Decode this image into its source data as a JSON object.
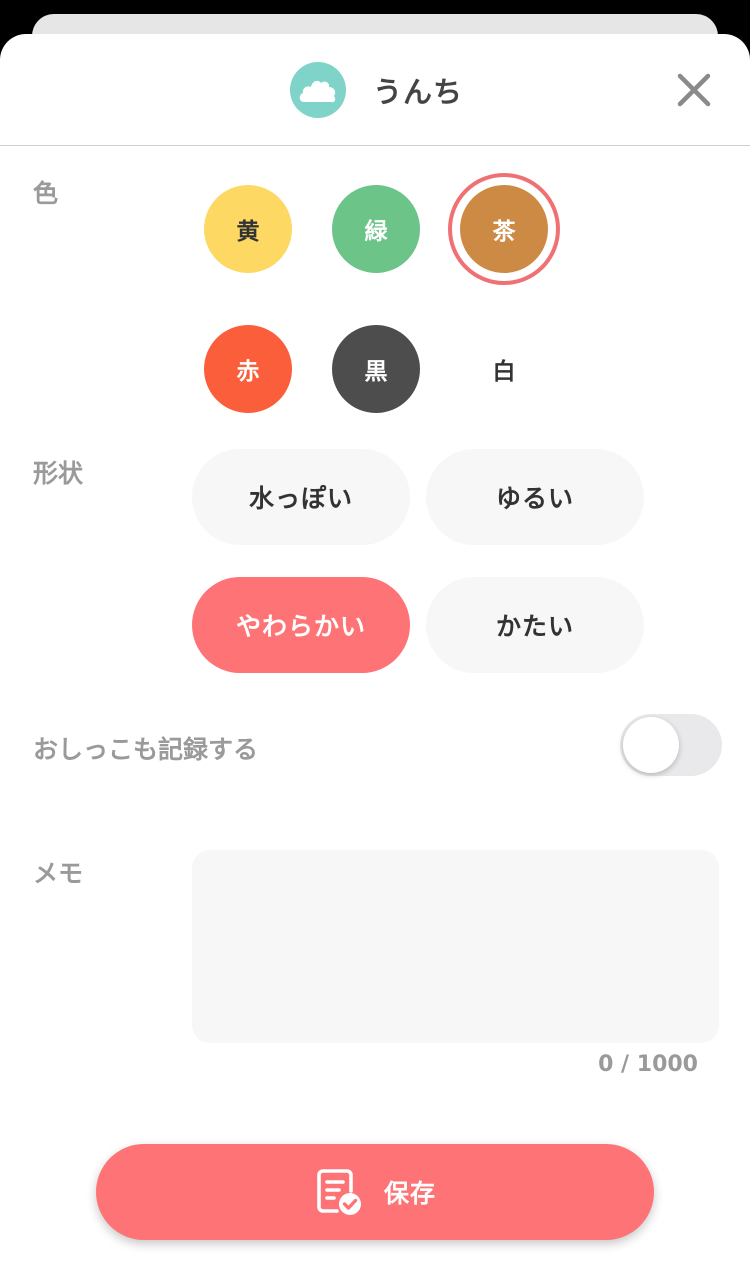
{
  "header": {
    "title": "うんち",
    "icon": "poop-cloud-icon",
    "close_icon": "close-icon"
  },
  "color_section": {
    "label": "色",
    "options": [
      {
        "label": "黄",
        "bg": "#fdd964",
        "fg": "#333333",
        "selected": false
      },
      {
        "label": "緑",
        "bg": "#6cc489",
        "fg": "#ffffff",
        "selected": false
      },
      {
        "label": "茶",
        "bg": "#cd8a45",
        "fg": "#ffffff",
        "selected": true
      },
      {
        "label": "赤",
        "bg": "#fb5e3b",
        "fg": "#ffffff",
        "selected": false
      },
      {
        "label": "黒",
        "bg": "#4d4d4d",
        "fg": "#ffffff",
        "selected": false
      },
      {
        "label": "白",
        "bg": "#ffffff",
        "fg": "#333333",
        "selected": false
      }
    ],
    "selected_ring_color": "#f07173"
  },
  "shape_section": {
    "label": "形状",
    "options": [
      {
        "label": "水っぽい",
        "selected": false
      },
      {
        "label": "ゆるい",
        "selected": false
      },
      {
        "label": "やわらかい",
        "selected": true
      },
      {
        "label": "かたい",
        "selected": false
      }
    ]
  },
  "pee_toggle": {
    "label": "おしっこも記録する",
    "on": false
  },
  "memo": {
    "label": "メモ",
    "value": "",
    "counter": "0 / 1000"
  },
  "save": {
    "label": "保存",
    "icon": "document-check-icon"
  },
  "colors": {
    "accent": "#fe7376",
    "title_icon_bg": "#7fd3c9"
  }
}
